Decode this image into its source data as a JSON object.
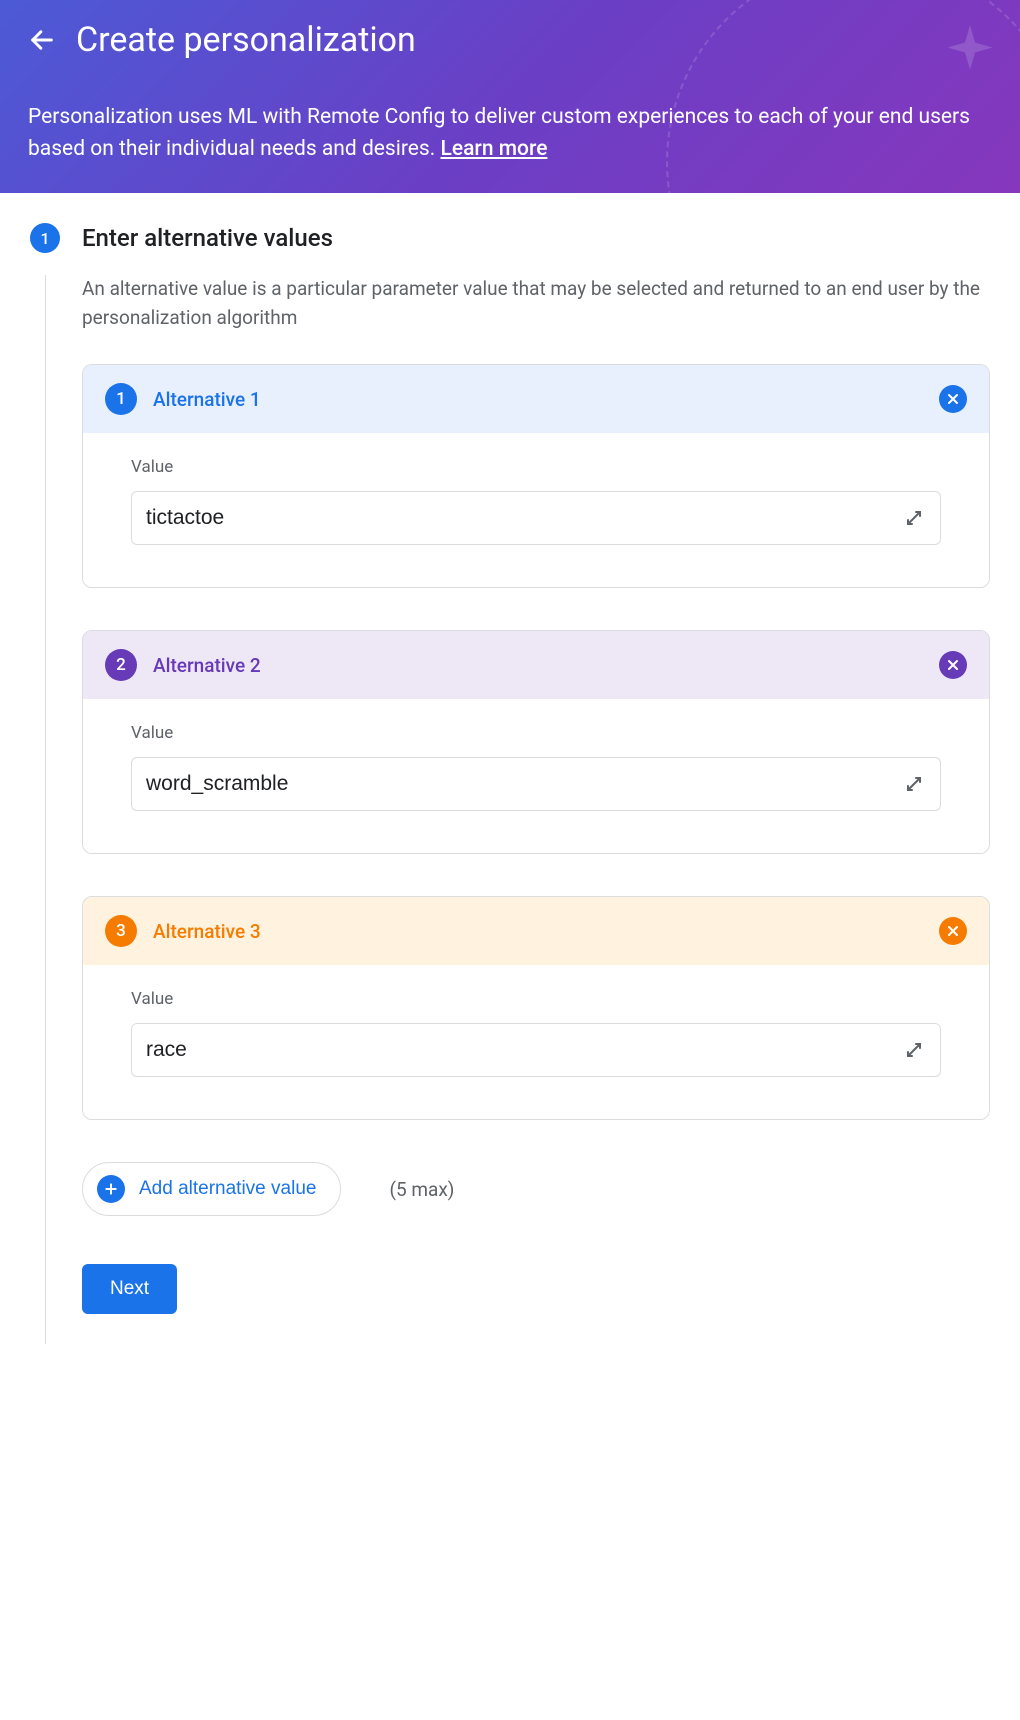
{
  "header": {
    "title": "Create personalization",
    "description": "Personalization uses ML with Remote Config to deliver custom experiences to each of your end users based on their individual needs and desires. ",
    "learn_more": "Learn more"
  },
  "step": {
    "number": "1",
    "title": "Enter alternative values",
    "description": "An alternative value is a particular parameter value that may be selected and returned to an end user by the personalization algorithm"
  },
  "alternatives": [
    {
      "num": "1",
      "label": "Alternative 1",
      "value_label": "Value",
      "value": "tictactoe"
    },
    {
      "num": "2",
      "label": "Alternative 2",
      "value_label": "Value",
      "value": "word_scramble"
    },
    {
      "num": "3",
      "label": "Alternative 3",
      "value_label": "Value",
      "value": "race"
    }
  ],
  "add": {
    "label": "Add alternative value",
    "max": "(5 max)"
  },
  "next_label": "Next"
}
